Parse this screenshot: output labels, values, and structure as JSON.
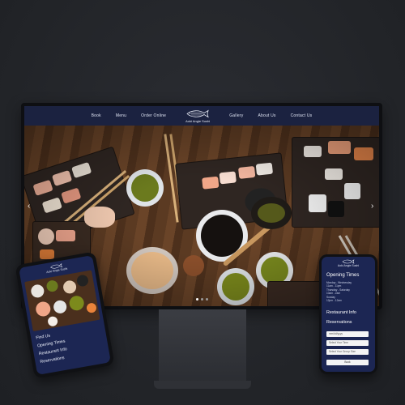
{
  "site": {
    "brand": "Aoki Angie Sushi",
    "nav_left": [
      "Book",
      "Menu",
      "Order Online"
    ],
    "nav_right": [
      "Gallery",
      "About Us",
      "Contact Us"
    ]
  },
  "mobile_left": {
    "brand": "Aoki Angie Sushi",
    "menu": [
      "Find Us",
      "Opening Times",
      "Restaurant Info",
      "Reservations"
    ]
  },
  "mobile_right": {
    "brand": "Aoki Angie Sushi",
    "opening_title": "Opening Times",
    "hours": "Monday - Wednesday\n11am - 11pm\nThursday - Saturday\n10am - 2am\nSunday\n12pm - 12am",
    "restaurant_info": "Restaurant Info",
    "reservations": "Reservations",
    "field_date": "mm/dd/yyyy",
    "field_time": "Select Your Time",
    "field_group": "Select Your Group Size",
    "book_label": "Book"
  },
  "colors": {
    "nav_bg": "#192242",
    "phone_bg": "#1c2653",
    "backdrop": "#25272c"
  }
}
